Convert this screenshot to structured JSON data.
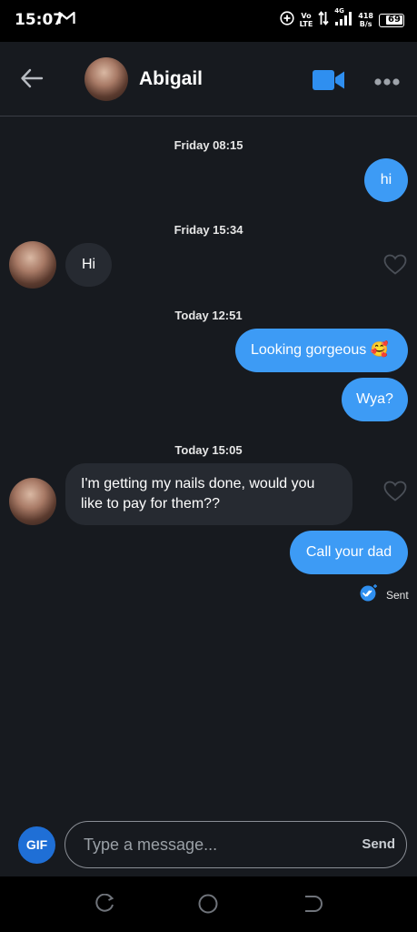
{
  "status_bar": {
    "time": "15:07",
    "lte_top": "Vo",
    "lte_bottom": "LTE",
    "net_type": "4G",
    "speed_value": "418",
    "speed_unit": "B/s",
    "battery": "69"
  },
  "header": {
    "contact_name": "Abigail"
  },
  "messages": [
    {
      "timestamp": "Friday 08:15"
    },
    {
      "direction": "out",
      "text": "hi"
    },
    {
      "timestamp": "Friday 15:34"
    },
    {
      "direction": "in",
      "text": "Hi"
    },
    {
      "timestamp": "Today 12:51"
    },
    {
      "direction": "out",
      "text": "Looking gorgeous 🥰"
    },
    {
      "direction": "out",
      "text": "Wya?"
    },
    {
      "timestamp": "Today 15:05"
    },
    {
      "direction": "in",
      "text": "I'm getting my nails done, would you like to pay for them??"
    },
    {
      "direction": "out",
      "text": "Call your dad"
    }
  ],
  "receipt": {
    "label": "Sent"
  },
  "composer": {
    "gif_label": "GIF",
    "placeholder": "Type a message...",
    "send_label": "Send"
  },
  "colors": {
    "background": "#171a1f",
    "outgoing_bubble": "#3d9bf5",
    "incoming_bubble": "#262a31",
    "accent": "#2f8ff0"
  }
}
